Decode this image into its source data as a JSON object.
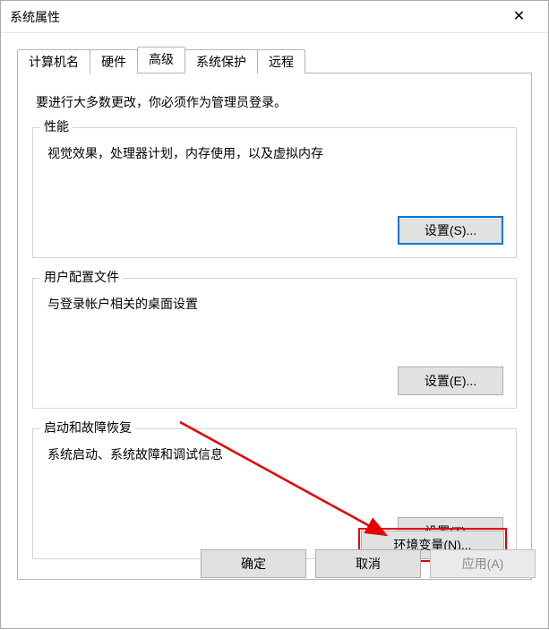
{
  "window": {
    "title": "系统属性"
  },
  "tabs": {
    "t0": "计算机名",
    "t1": "硬件",
    "t2": "高级",
    "t3": "系统保护",
    "t4": "远程"
  },
  "intro": "要进行大多数更改，你必须作为管理员登录。",
  "groups": {
    "perf": {
      "legend": "性能",
      "desc": "视觉效果，处理器计划，内存使用，以及虚拟内存",
      "button": "设置(S)..."
    },
    "profile": {
      "legend": "用户配置文件",
      "desc": "与登录帐户相关的桌面设置",
      "button": "设置(E)..."
    },
    "startup": {
      "legend": "启动和故障恢复",
      "desc": "系统启动、系统故障和调试信息",
      "button": "设置(T)..."
    }
  },
  "envvar_button": "环境变量(N)...",
  "footer": {
    "ok": "确定",
    "cancel": "取消",
    "apply": "应用(A)"
  }
}
